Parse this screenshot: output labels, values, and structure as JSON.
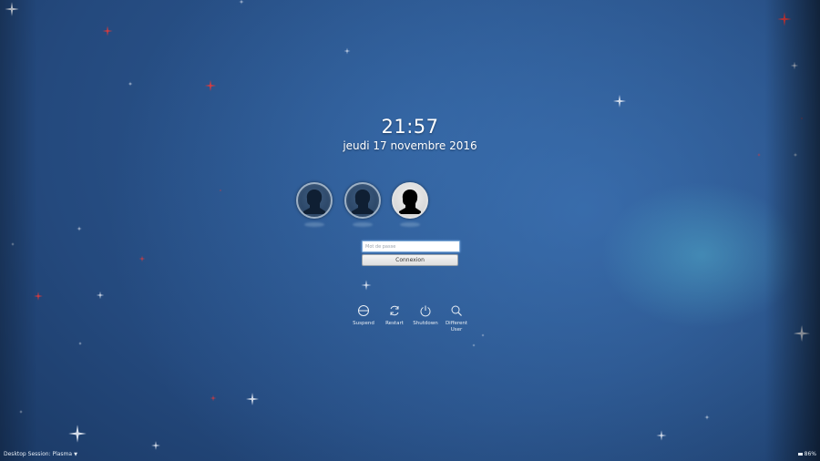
{
  "clock": {
    "time": "21:57",
    "date": "jeudi 17 novembre 2016"
  },
  "users": [
    {
      "name": "",
      "selected": false
    },
    {
      "name": "",
      "selected": false
    },
    {
      "name": "",
      "selected": true
    }
  ],
  "login": {
    "password_placeholder": "Mot de passe",
    "connect_label": "Connexion"
  },
  "actions": {
    "suspend": {
      "label": "Suspend",
      "icon": "suspend-icon"
    },
    "restart": {
      "label": "Restart",
      "icon": "restart-icon"
    },
    "shutdown": {
      "label": "Shutdown",
      "icon": "power-icon"
    },
    "different_user": {
      "label": "Different User",
      "icon": "search-icon"
    }
  },
  "footer": {
    "session": "Desktop Session: Plasma",
    "battery": "86%"
  },
  "colors": {
    "background": "#24497d",
    "accent": "#7aa7d6",
    "red_star": "#e23a3a"
  }
}
